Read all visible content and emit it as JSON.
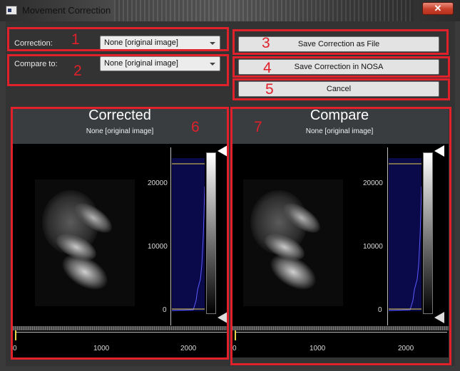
{
  "window": {
    "title": "Movement Correction",
    "close_glyph": "✕"
  },
  "form": {
    "correction_label": "Correction:",
    "correction_value": "None [original image]",
    "compare_label": "Compare to:",
    "compare_value": "None [original image]"
  },
  "buttons": {
    "save_file": "Save Correction as File",
    "save_nosa": "Save Correction in NOSA",
    "cancel": "Cancel"
  },
  "annotations": [
    "1",
    "2",
    "3",
    "4",
    "5",
    "6",
    "7"
  ],
  "panels": [
    {
      "title": "Corrected",
      "subtitle": "None [original image]",
      "y_ticks": [
        "20000",
        "10000",
        "0"
      ],
      "x_ticks": [
        "0",
        "1000",
        "2000"
      ]
    },
    {
      "title": "Compare",
      "subtitle": "None [original image]",
      "y_ticks": [
        "20000",
        "10000",
        "0"
      ],
      "x_ticks": [
        "0",
        "1000",
        "2000"
      ]
    }
  ],
  "colors": {
    "annotation": "#e0202a",
    "histogram_fill": "#0a0a4a",
    "histogram_line": "#5a5aff",
    "level_line": "#e8d44d"
  }
}
